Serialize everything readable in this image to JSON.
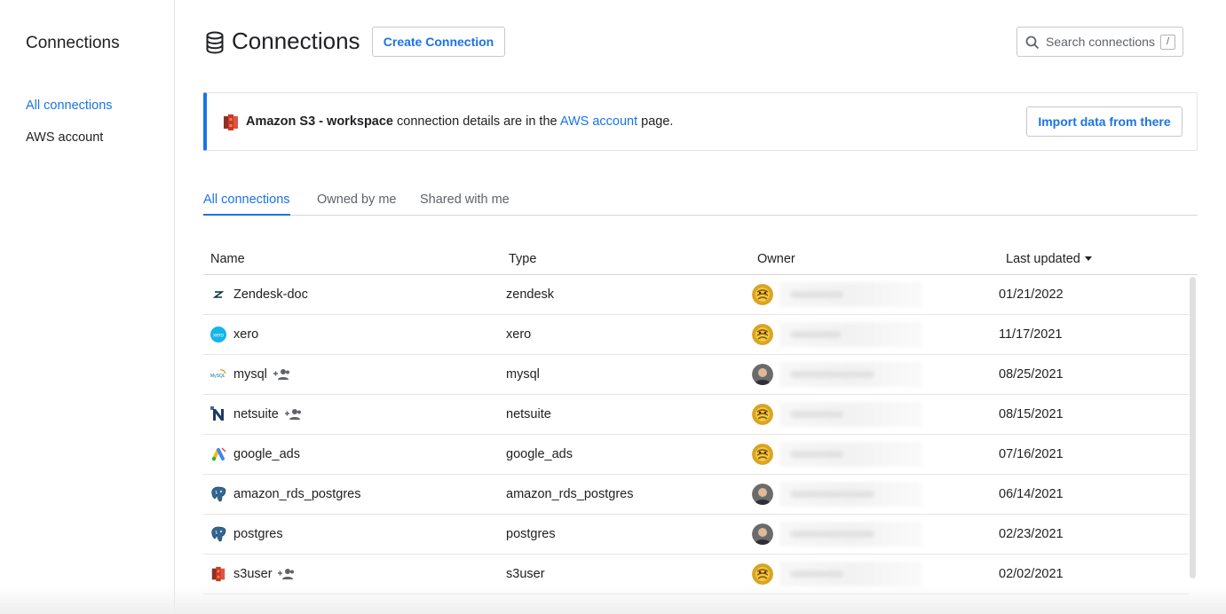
{
  "sidebar": {
    "title": "Connections",
    "items": [
      {
        "label": "All connections",
        "active": true
      },
      {
        "label": "AWS account",
        "active": false
      }
    ]
  },
  "header": {
    "title": "Connections",
    "icon": "database-icon",
    "create_label": "Create Connection",
    "search_placeholder": "Search connections",
    "search_shortcut": "/"
  },
  "banner": {
    "icon": "amazon-s3-icon",
    "bold_text": "Amazon S3 - workspace",
    "text_before_link": " connection details are in the ",
    "link_text": "AWS account",
    "text_after_link": " page.",
    "button_label": "Import data from there"
  },
  "tabs": [
    {
      "label": "All connections",
      "active": true
    },
    {
      "label": "Owned by me",
      "active": false
    },
    {
      "label": "Shared with me",
      "active": false
    }
  ],
  "table": {
    "columns": [
      "Name",
      "Type",
      "Owner",
      "Last updated"
    ],
    "sort_column": "Last updated",
    "rows": [
      {
        "name": "Zendesk-doc",
        "type": "zendesk",
        "date": "01/21/2022",
        "shared": false,
        "icon": "zendesk-icon",
        "avatar": "bee-avatar"
      },
      {
        "name": "xero",
        "type": "xero",
        "date": "11/17/2021",
        "shared": false,
        "icon": "xero-icon",
        "avatar": "bee-avatar"
      },
      {
        "name": "mysql",
        "type": "mysql",
        "date": "08/25/2021",
        "shared": true,
        "icon": "mysql-icon",
        "avatar": "person-avatar"
      },
      {
        "name": "netsuite",
        "type": "netsuite",
        "date": "08/15/2021",
        "shared": true,
        "icon": "netsuite-icon",
        "avatar": "bee-avatar"
      },
      {
        "name": "google_ads",
        "type": "google_ads",
        "date": "07/16/2021",
        "shared": false,
        "icon": "google-ads-icon",
        "avatar": "bee-avatar"
      },
      {
        "name": "amazon_rds_postgres",
        "type": "amazon_rds_postgres",
        "date": "06/14/2021",
        "shared": false,
        "icon": "postgres-icon",
        "avatar": "person-avatar"
      },
      {
        "name": "postgres",
        "type": "postgres",
        "date": "02/23/2021",
        "shared": false,
        "icon": "postgres-icon",
        "avatar": "person-avatar"
      },
      {
        "name": "s3user",
        "type": "s3user",
        "date": "02/02/2021",
        "shared": true,
        "icon": "amazon-s3-icon",
        "avatar": "bee-avatar"
      }
    ]
  },
  "colors": {
    "accent": "#1a73e8",
    "text": "#202124",
    "muted": "#5f6368",
    "border": "#d6d6d6"
  }
}
